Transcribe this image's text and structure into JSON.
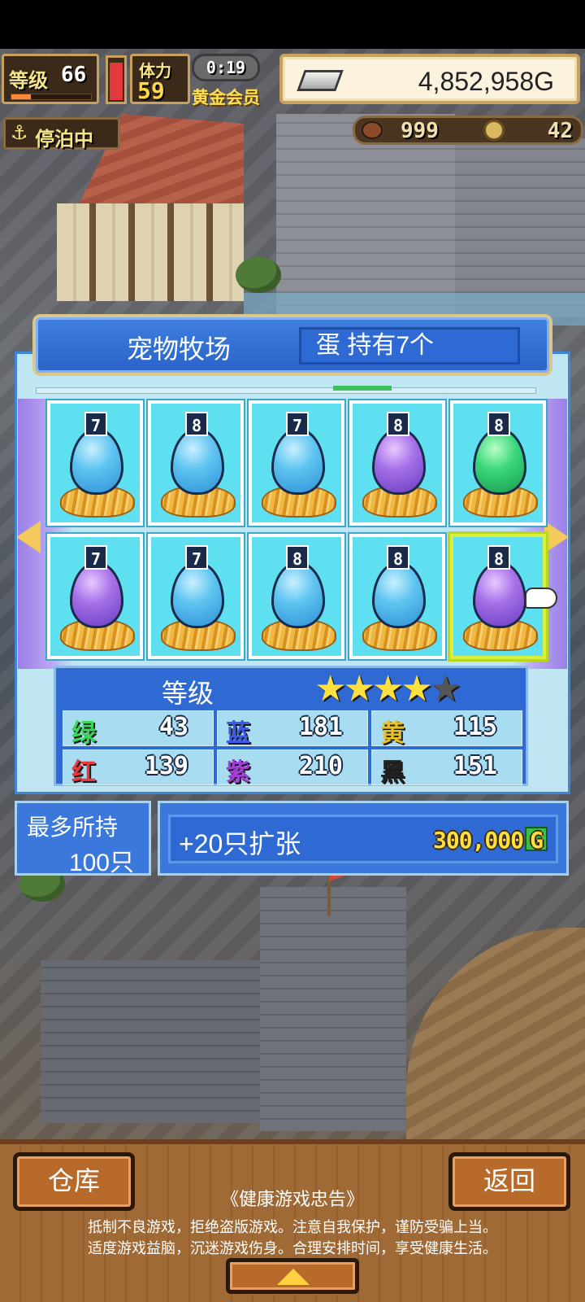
{
  "hud": {
    "level_label": "等级",
    "level_value": "66",
    "stamina_label": "体力",
    "stamina_value": "59",
    "timer": "0:19",
    "membership": "黄金会员",
    "gold": "4,852,958G",
    "dock_status": "停泊中",
    "resource_1": "999",
    "resource_2": "42",
    "xp_fraction": 0.24,
    "stamina_fraction": 0.85
  },
  "ranch": {
    "title": "宠物牧场",
    "egg_count": "蛋 持有7个",
    "eggs": [
      {
        "level": "7",
        "color": "blue"
      },
      {
        "level": "8",
        "color": "blue"
      },
      {
        "level": "7",
        "color": "blue"
      },
      {
        "level": "8",
        "color": "purple"
      },
      {
        "level": "8",
        "color": "green"
      },
      {
        "level": "7",
        "color": "purple"
      },
      {
        "level": "7",
        "color": "blue"
      },
      {
        "level": "8",
        "color": "blue"
      },
      {
        "level": "8",
        "color": "blue"
      },
      {
        "level": "8",
        "color": "purple",
        "selected": true
      }
    ],
    "grade_label": "等级",
    "grade_stars": 4,
    "grade_max": 5,
    "stats": [
      {
        "key": "绿",
        "value": "43",
        "color": "#3ad85a"
      },
      {
        "key": "蓝",
        "value": "181",
        "color": "#3a5ae8"
      },
      {
        "key": "黄",
        "value": "115",
        "color": "#e8c020"
      },
      {
        "key": "红",
        "value": "139",
        "color": "#e83a3a"
      },
      {
        "key": "紫",
        "value": "210",
        "color": "#a040d8"
      },
      {
        "key": "黑",
        "value": "151",
        "color": "#222222"
      }
    ],
    "capacity_label": "最多所持",
    "capacity_value": "100只",
    "expand_label": "+20只扩张",
    "expand_price": "300,000",
    "expand_currency": "G"
  },
  "footer": {
    "left_button": "仓库",
    "right_button": "返回",
    "notice_title": "《健康游戏忠告》",
    "notice_line1": "抵制不良游戏，拒绝盗版游戏。注意自我保护，谨防受骗上当。",
    "notice_line2": "适度游戏益脑，沉迷游戏伤身。合理安排时间，享受健康生活。"
  }
}
